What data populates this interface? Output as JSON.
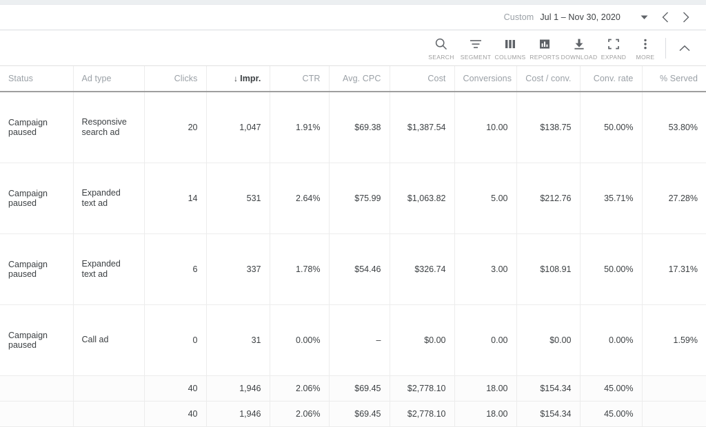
{
  "daterange": {
    "label": "Custom",
    "value": "Jul 1 – Nov 30, 2020",
    "dropdown_icon": "chevron-down-icon",
    "prev_icon": "chevron-left-icon",
    "next_icon": "chevron-right-icon"
  },
  "toolbar": {
    "items": [
      {
        "label": "SEARCH",
        "icon": "search-icon"
      },
      {
        "label": "SEGMENT",
        "icon": "segment-icon"
      },
      {
        "label": "COLUMNS",
        "icon": "columns-icon"
      },
      {
        "label": "REPORTS",
        "icon": "reports-icon"
      },
      {
        "label": "DOWNLOAD",
        "icon": "download-icon"
      },
      {
        "label": "EXPAND",
        "icon": "expand-icon"
      },
      {
        "label": "MORE",
        "icon": "more-vert-icon"
      }
    ],
    "collapse_icon": "chevron-up-icon"
  },
  "table": {
    "sort_column": "Impr.",
    "sort_direction": "desc",
    "sort_arrow": "↓",
    "columns": [
      {
        "label": "Status",
        "align": "left"
      },
      {
        "label": "Ad type",
        "align": "left"
      },
      {
        "label": "Clicks",
        "align": "right"
      },
      {
        "label": "Impr.",
        "align": "right"
      },
      {
        "label": "CTR",
        "align": "right"
      },
      {
        "label": "Avg. CPC",
        "align": "right"
      },
      {
        "label": "Cost",
        "align": "right"
      },
      {
        "label": "Conversions",
        "align": "right"
      },
      {
        "label": "Cost / conv.",
        "align": "right"
      },
      {
        "label": "Conv. rate",
        "align": "right"
      },
      {
        "label": "% Served",
        "align": "right"
      }
    ],
    "rows": [
      {
        "status": "Campaign paused",
        "ad_type": "Responsive search ad",
        "clicks": "20",
        "impr": "1,047",
        "ctr": "1.91%",
        "avg_cpc": "$69.38",
        "cost": "$1,387.54",
        "conversions": "10.00",
        "cost_per_conv": "$138.75",
        "conv_rate": "50.00%",
        "pct_served": "53.80%"
      },
      {
        "status": "Campaign paused",
        "ad_type": "Expanded text ad",
        "clicks": "14",
        "impr": "531",
        "ctr": "2.64%",
        "avg_cpc": "$75.99",
        "cost": "$1,063.82",
        "conversions": "5.00",
        "cost_per_conv": "$212.76",
        "conv_rate": "35.71%",
        "pct_served": "27.28%"
      },
      {
        "status": "Campaign paused",
        "ad_type": "Expanded text ad",
        "clicks": "6",
        "impr": "337",
        "ctr": "1.78%",
        "avg_cpc": "$54.46",
        "cost": "$326.74",
        "conversions": "3.00",
        "cost_per_conv": "$108.91",
        "conv_rate": "50.00%",
        "pct_served": "17.31%"
      },
      {
        "status": "Campaign paused",
        "ad_type": "Call ad",
        "clicks": "0",
        "impr": "31",
        "ctr": "0.00%",
        "avg_cpc": "–",
        "cost": "$0.00",
        "conversions": "0.00",
        "cost_per_conv": "$0.00",
        "conv_rate": "0.00%",
        "pct_served": "1.59%"
      }
    ],
    "totals": [
      {
        "status": "",
        "ad_type": "",
        "clicks": "40",
        "impr": "1,946",
        "ctr": "2.06%",
        "avg_cpc": "$69.45",
        "cost": "$2,778.10",
        "conversions": "18.00",
        "cost_per_conv": "$154.34",
        "conv_rate": "45.00%",
        "pct_served": ""
      },
      {
        "status": "",
        "ad_type": "",
        "clicks": "40",
        "impr": "1,946",
        "ctr": "2.06%",
        "avg_cpc": "$69.45",
        "cost": "$2,778.10",
        "conversions": "18.00",
        "cost_per_conv": "$154.34",
        "conv_rate": "45.00%",
        "pct_served": ""
      }
    ]
  },
  "colors": {
    "text": "#3c4043",
    "muted": "#9aa0a6",
    "status": "#b0b4b8",
    "border": "#ececec",
    "header_rule": "#9e9e9e",
    "total_bg": "#fcfcfc"
  }
}
